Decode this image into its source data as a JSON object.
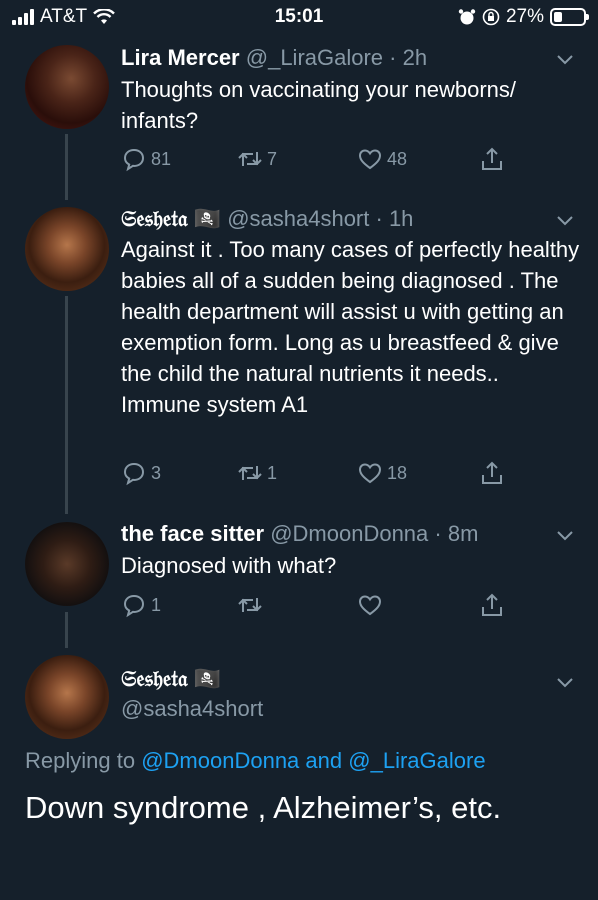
{
  "status": {
    "carrier": "AT&T",
    "time": "15:01",
    "battery": "27%",
    "battery_level": 0.27
  },
  "tweets": [
    {
      "name": "Lira Mercer",
      "handle": "@_LiraGalore",
      "time": "· 2h",
      "text": "Thoughts on vaccinating your newborns/ infants?",
      "replies": "81",
      "retweets": "7",
      "likes": "48"
    },
    {
      "name": "𝔖𝔢𝔰𝔥𝔢𝔱𝔞",
      "emoji": "🏴‍☠️",
      "handle": "@sasha4short",
      "time": "· 1h",
      "text": "Against it . Too many cases of perfectly healthy babies all of a sudden being diagnosed . The health department will assist u with getting an exemption form. Long as u breastfeed & give the child the natural nutrients it needs.. Immune system A1",
      "replies": "3",
      "retweets": "1",
      "likes": "18"
    },
    {
      "name": "the face sitter",
      "handle": "@DmoonDonna",
      "time": "· 8m",
      "text": "Diagnosed with what?",
      "replies": "1",
      "retweets": "",
      "likes": ""
    }
  ],
  "focused": {
    "name": "𝔖𝔢𝔰𝔥𝔢𝔱𝔞",
    "emoji": "🏴‍☠️",
    "handle": "@sasha4short",
    "replying_prefix": "Replying to",
    "replying_to_1": "@DmoonDonna",
    "replying_and": "and",
    "replying_to_2": "@_LiraGalore",
    "text": "Down syndrome , Alzheimer’s, etc."
  }
}
